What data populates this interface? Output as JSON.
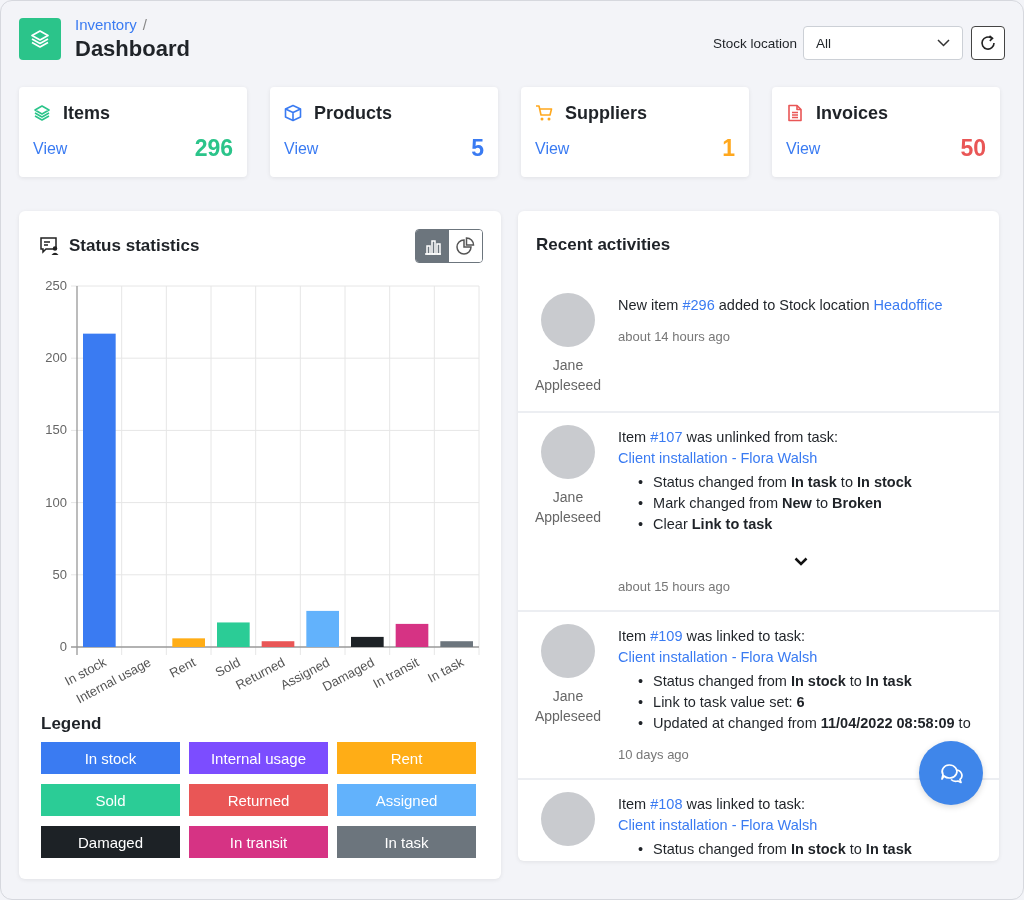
{
  "header": {
    "breadcrumb": "Inventory",
    "separator": "/",
    "title": "Dashboard",
    "stock_location": {
      "label": "Stock location",
      "value": "All"
    }
  },
  "stat_cards": [
    {
      "kind": "items",
      "title": "Items",
      "link": "View",
      "count": "296",
      "color": "#2bc48a"
    },
    {
      "kind": "products",
      "title": "Products",
      "link": "View",
      "count": "5",
      "color": "#3a7bf2"
    },
    {
      "kind": "suppliers",
      "title": "Suppliers",
      "link": "View",
      "count": "1",
      "color": "#ffa81e"
    },
    {
      "kind": "invoices",
      "title": "Invoices",
      "link": "View",
      "count": "50",
      "color": "#e95656"
    }
  ],
  "status_statistics": {
    "title": "Status statistics",
    "view_toggle": [
      {
        "kind": "bar",
        "selected": true
      },
      {
        "kind": "pie",
        "selected": false
      }
    ],
    "chart_data": {
      "type": "bar",
      "categories": [
        "In stock",
        "Internal usage",
        "Rent",
        "Sold",
        "Returned",
        "Assigned",
        "Damaged",
        "In transit",
        "In task"
      ],
      "series": [
        {
          "values": [
            217,
            0,
            6,
            17,
            4,
            25,
            7,
            16,
            4
          ]
        }
      ],
      "ylim": [
        0,
        250
      ],
      "yticks": [
        0,
        50,
        100,
        150,
        200,
        250
      ],
      "grid": true
    },
    "legend_title": "Legend",
    "legend": [
      {
        "label": "In stock",
        "color": "#3a7bf2"
      },
      {
        "label": "Internal usage",
        "color": "#7c4dff"
      },
      {
        "label": "Rent",
        "color": "#ffad16"
      },
      {
        "label": "Sold",
        "color": "#2bcc96"
      },
      {
        "label": "Returned",
        "color": "#e95656"
      },
      {
        "label": "Assigned",
        "color": "#62b2fc"
      },
      {
        "label": "Damaged",
        "color": "#1d2226"
      },
      {
        "label": "In transit",
        "color": "#d63384"
      },
      {
        "label": "In task",
        "color": "#6c757d"
      }
    ]
  },
  "recent_activities": {
    "title": "Recent activities",
    "items": [
      {
        "user": "Jane Appleseed",
        "message": [
          {
            "kind": "text",
            "text": "New item "
          },
          {
            "kind": "link",
            "text": "#296"
          },
          {
            "kind": "text",
            "text": " added to Stock location "
          },
          {
            "kind": "link",
            "text": "Headoffice"
          }
        ],
        "show_more": false,
        "time": "about 14 hours ago"
      },
      {
        "user": "Jane Appleseed",
        "message": [
          {
            "kind": "text",
            "text": "Item "
          },
          {
            "kind": "link",
            "text": "#107"
          },
          {
            "kind": "text",
            "text": " was unlinked from task: "
          },
          {
            "kind": "link",
            "text": "Client installation - Flora Walsh"
          }
        ],
        "changes": [
          {
            "bullet": "•",
            "text": "Status changed from **In task** to **In stock**"
          },
          {
            "bullet": "•",
            "text": "Mark changed from **New** to **Broken**"
          },
          {
            "bullet": "•",
            "text": "Clear **Link to task**"
          }
        ],
        "show_more": true,
        "time": "about 15 hours ago"
      },
      {
        "user": "Jane Appleseed",
        "message": [
          {
            "kind": "text",
            "text": "Item "
          },
          {
            "kind": "link",
            "text": "#109"
          },
          {
            "kind": "text",
            "text": " was linked to task: "
          },
          {
            "kind": "link",
            "text": "Client installation - Flora Walsh"
          }
        ],
        "changes": [
          {
            "bullet": "•",
            "text": "Status changed from **In stock** to **In task**"
          },
          {
            "bullet": "•",
            "text": "Link to task value set: **6**"
          },
          {
            "bullet": "•",
            "text": "Updated at changed from **11/04/2022 08:58:09** to"
          }
        ],
        "show_more": false,
        "time": "10 days ago"
      },
      {
        "message": [
          {
            "kind": "text",
            "text": "Item "
          },
          {
            "kind": "link",
            "text": "#108"
          },
          {
            "kind": "text",
            "text": " was linked to task: "
          },
          {
            "kind": "link",
            "text": "Client installation - Flora Walsh"
          }
        ],
        "changes": [
          {
            "bullet": "•",
            "text": "Status changed from **In stock** to **In task**"
          }
        ],
        "show_more": false
      }
    ]
  }
}
